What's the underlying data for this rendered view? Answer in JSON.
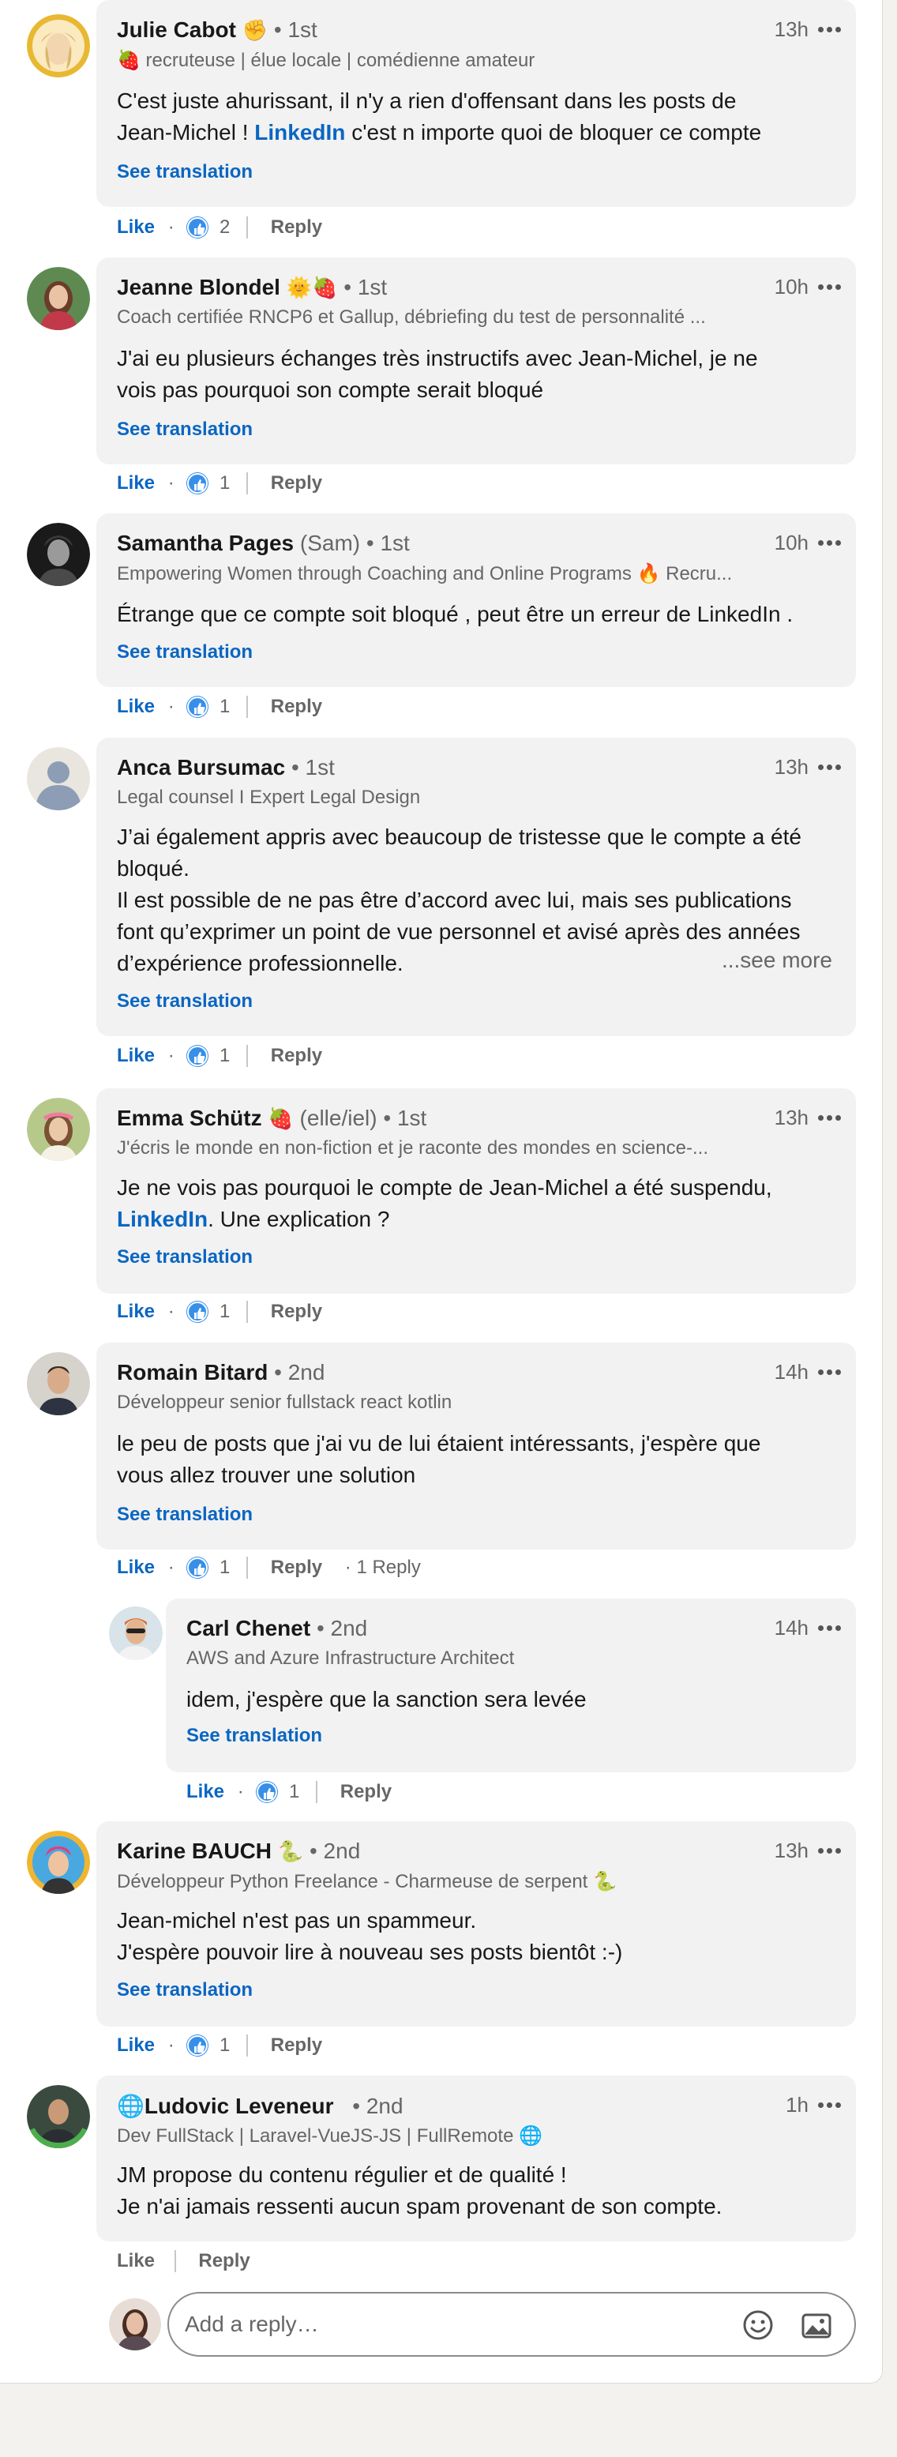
{
  "comments": [
    {
      "name": "Julie Cabot",
      "name_emoji": "✊",
      "degree": "• 1st",
      "time": "13h",
      "headline": "🍓 recruteuse | élue locale | comédienne amateur",
      "body_lines": [
        "C'est juste ahurissant, il n'y a rien d'offensant dans les posts de",
        [
          "Jean-Michel ! ",
          "LinkedIn",
          " c'est n importe quoi de bloquer ce compte"
        ]
      ],
      "translate": "See translation",
      "like": "Like",
      "reactions": "2",
      "reply": "Reply"
    },
    {
      "name": "Jeanne Blondel",
      "name_emoji": "🌞🍓",
      "degree": "• 1st",
      "time": "10h",
      "headline": "Coach certifiée RNCP6 et Gallup, débriefing du test de personnalité ...",
      "body_lines": [
        "J'ai eu plusieurs échanges très instructifs avec Jean-Michel, je ne",
        "vois pas pourquoi son compte serait bloqué"
      ],
      "translate": "See translation",
      "like": "Like",
      "reactions": "1",
      "reply": "Reply"
    },
    {
      "name": "Samantha Pages",
      "pronouns": "(Sam)",
      "degree": "• 1st",
      "time": "10h",
      "headline": "Empowering Women through Coaching and Online Programs 🔥 Recru...",
      "body_lines": [
        "Étrange que ce compte soit bloqué , peut être un erreur de LinkedIn ."
      ],
      "translate": "See translation",
      "like": "Like",
      "reactions": "1",
      "reply": "Reply"
    },
    {
      "name": "Anca Bursumac",
      "degree": "• 1st",
      "time": "13h",
      "headline": "Legal counsel I Expert Legal Design",
      "body_lines": [
        "J’ai également appris avec beaucoup de tristesse que le compte a été",
        "bloqué.",
        "Il est possible de ne pas être d’accord avec lui, mais ses publications",
        "font qu’exprimer un point de vue personnel et avisé après des années",
        "d’expérience professionnelle."
      ],
      "see_more": "...see more",
      "translate": "See translation",
      "like": "Like",
      "reactions": "1",
      "reply": "Reply"
    },
    {
      "name": "Emma Schütz",
      "name_emoji": "🍓",
      "pronouns": "(elle/iel)",
      "degree": "• 1st",
      "time": "13h",
      "headline": "J'écris le monde en non-fiction et je raconte des mondes en science-...",
      "body_lines": [
        "Je ne vois pas pourquoi le compte de Jean-Michel a été suspendu,",
        [
          "",
          "LinkedIn",
          ". Une explication ?"
        ]
      ],
      "translate": "See translation",
      "like": "Like",
      "reactions": "1",
      "reply": "Reply"
    },
    {
      "name": "Romain Bitard",
      "degree": "• 2nd",
      "time": "14h",
      "headline": "Développeur senior fullstack react kotlin",
      "body_lines": [
        "le peu de posts que j'ai vu de lui étaient intéressants, j'espère que",
        "vous allez trouver une solution"
      ],
      "translate": "See translation",
      "like": "Like",
      "reactions": "1",
      "reply": "Reply",
      "reply_count": "· 1 Reply"
    },
    {
      "name": "Carl Chenet",
      "degree": "• 2nd",
      "time": "14h",
      "headline": "AWS and Azure Infrastructure Architect",
      "body_lines": [
        "idem, j'espère que la sanction sera levée"
      ],
      "translate": "See translation",
      "like": "Like",
      "reactions": "1",
      "reply": "Reply"
    },
    {
      "name": "Karine BAUCH",
      "name_emoji": "🐍",
      "degree": "• 2nd",
      "time": "13h",
      "headline": "Développeur Python Freelance - Charmeuse de serpent 🐍",
      "body_lines": [
        "Jean-michel n'est pas un spammeur.",
        "J'espère pouvoir lire à nouveau ses posts bientôt :-)"
      ],
      "translate": "See translation",
      "like": "Like",
      "reactions": "1",
      "reply": "Reply"
    },
    {
      "name": "🌐Ludovic Leveneur",
      "degree": "• 2nd",
      "time": "1h",
      "headline": "Dev FullStack | Laravel-VueJS-JS | FullRemote 🌐",
      "body_lines": [
        "JM propose du contenu régulier et de qualité !",
        "Je n'ai jamais ressenti aucun spam provenant de son compte."
      ],
      "like": "Like",
      "reply": "Reply"
    }
  ],
  "composer": {
    "placeholder": "Add a reply…",
    "emoji_icon": "emoji-smile-icon",
    "image_icon": "image-icon"
  },
  "colors": {
    "link": "#0a66c2",
    "reaction": "#378fe9",
    "bubble": "#f2f2f2"
  }
}
